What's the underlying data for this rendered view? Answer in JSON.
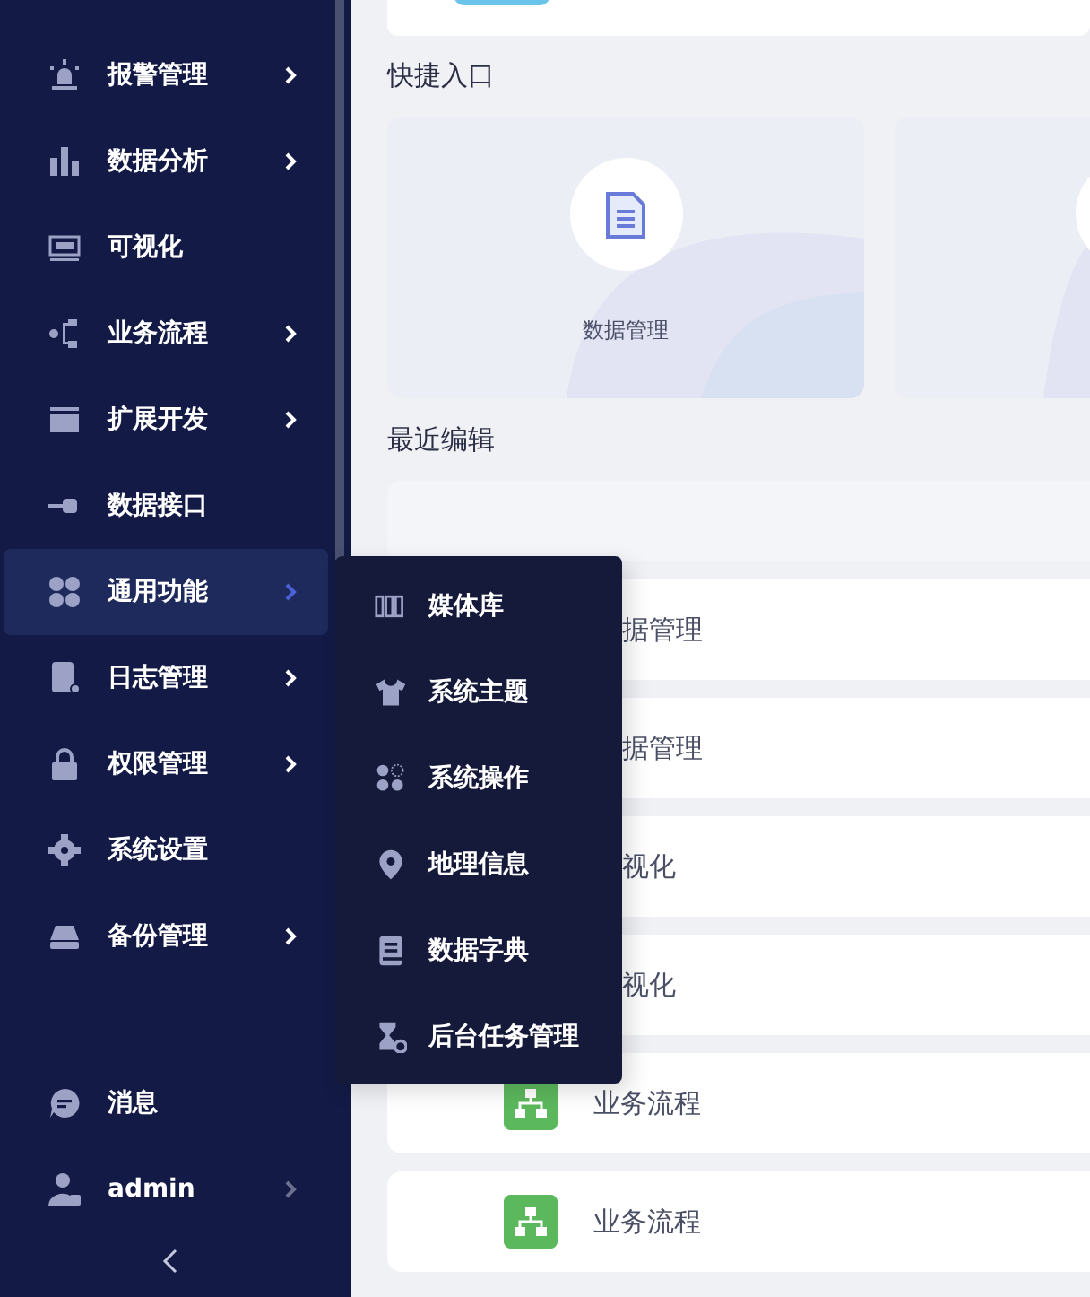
{
  "sidebar": {
    "items": [
      {
        "label": "报警管理",
        "has_submenu": true,
        "selected": false
      },
      {
        "label": "数据分析",
        "has_submenu": true,
        "selected": false
      },
      {
        "label": "可视化",
        "has_submenu": false,
        "selected": false
      },
      {
        "label": "业务流程",
        "has_submenu": true,
        "selected": false
      },
      {
        "label": "扩展开发",
        "has_submenu": true,
        "selected": false
      },
      {
        "label": "数据接口",
        "has_submenu": false,
        "selected": false
      },
      {
        "label": "通用功能",
        "has_submenu": true,
        "selected": true
      },
      {
        "label": "日志管理",
        "has_submenu": true,
        "selected": false
      },
      {
        "label": "权限管理",
        "has_submenu": true,
        "selected": false
      },
      {
        "label": "系统设置",
        "has_submenu": false,
        "selected": false
      },
      {
        "label": "备份管理",
        "has_submenu": true,
        "selected": false
      }
    ],
    "footer": [
      {
        "label": "消息",
        "has_submenu": false
      },
      {
        "label": "admin",
        "has_submenu": true
      }
    ]
  },
  "flyout": {
    "items": [
      {
        "label": "媒体库"
      },
      {
        "label": "系统主题"
      },
      {
        "label": "系统操作"
      },
      {
        "label": "地理信息"
      },
      {
        "label": "数据字典"
      },
      {
        "label": "后台任务管理"
      }
    ]
  },
  "quick_entry": {
    "title": "快捷入口",
    "cards": [
      {
        "kind": "full",
        "label": "数据管理"
      },
      {
        "kind": "cut"
      }
    ]
  },
  "recent": {
    "title": "最近编辑",
    "rows": [
      {
        "kind": "header"
      },
      {
        "kind": "covered",
        "label": "据管理"
      },
      {
        "kind": "covered",
        "label": "据管理"
      },
      {
        "kind": "covered",
        "label": "视化"
      },
      {
        "kind": "covered",
        "label": "视化"
      },
      {
        "kind": "full",
        "label": "业务流程"
      },
      {
        "kind": "full",
        "label": "业务流程"
      }
    ]
  }
}
